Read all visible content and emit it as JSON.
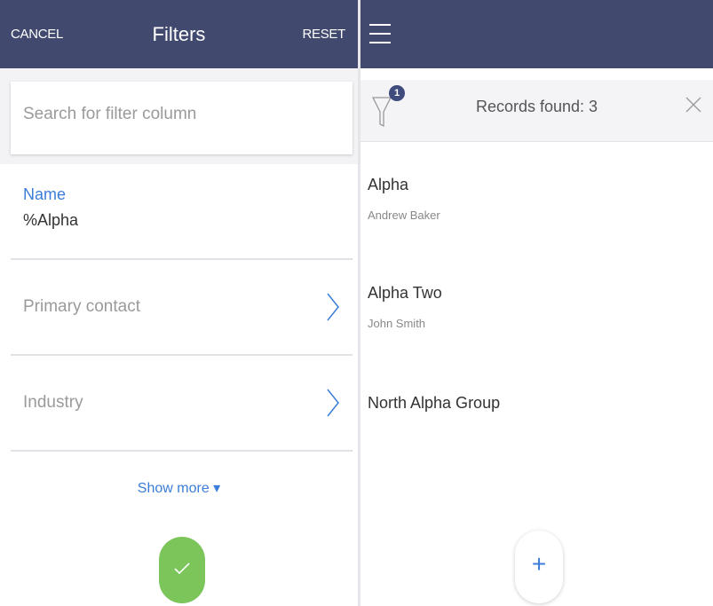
{
  "filters_panel": {
    "header": {
      "cancel_label": "CANCEL",
      "title": "Filters",
      "reset_label": "RESET"
    },
    "search": {
      "placeholder": "Search for filter column",
      "value": ""
    },
    "name_filter": {
      "label": "Name",
      "value": "%Alpha"
    },
    "rows": [
      {
        "label": "Primary contact",
        "icon": "chevron-right-icon"
      },
      {
        "label": "Industry",
        "icon": "chevron-right-icon"
      }
    ],
    "show_more_label": "Show more ▾",
    "apply_icon": "checkmark-icon",
    "colors": {
      "header_bg": "#414a6e",
      "accent": "#3b7dd8",
      "apply_green": "#7bc55b"
    }
  },
  "records_panel": {
    "header": {
      "menu_icon": "hamburger-menu-icon"
    },
    "filter_bar": {
      "filter_icon": "funnel-icon",
      "badge_count": "1",
      "records_text": "Records found: 3",
      "close_icon": "close-icon"
    },
    "records": [
      {
        "title": "Alpha",
        "subtitle": "Andrew Baker"
      },
      {
        "title": "Alpha Two",
        "subtitle": "John Smith"
      },
      {
        "title": "North Alpha Group",
        "subtitle": ""
      }
    ],
    "add_button_icon": "plus-icon"
  }
}
